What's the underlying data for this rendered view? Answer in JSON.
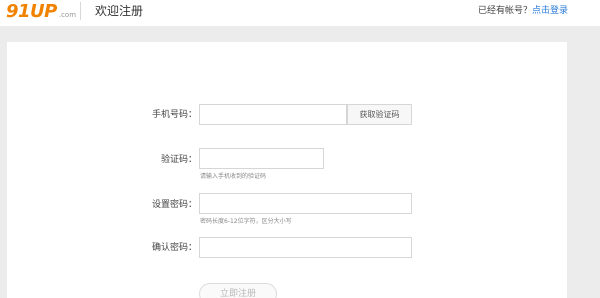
{
  "header": {
    "logo": "91UP",
    "logo_suffix": ".com",
    "title": "欢迎注册",
    "login_prompt": "已经有帐号？",
    "login_link": "点击登录"
  },
  "form": {
    "phone": {
      "label": "手机号码：",
      "value": "",
      "code_button": "获取验证码"
    },
    "code": {
      "label": "验证码：",
      "value": "",
      "hint": "请输入手机收到的验证码"
    },
    "password": {
      "label": "设置密码：",
      "value": "",
      "hint": "密码长度6-12位字符，区分大小写"
    },
    "confirm": {
      "label": "确认密码：",
      "value": ""
    },
    "submit_label": "立即注册"
  },
  "colors": {
    "brand": "#f08200",
    "link": "#2a7ad8",
    "page_background": "#ececec"
  }
}
